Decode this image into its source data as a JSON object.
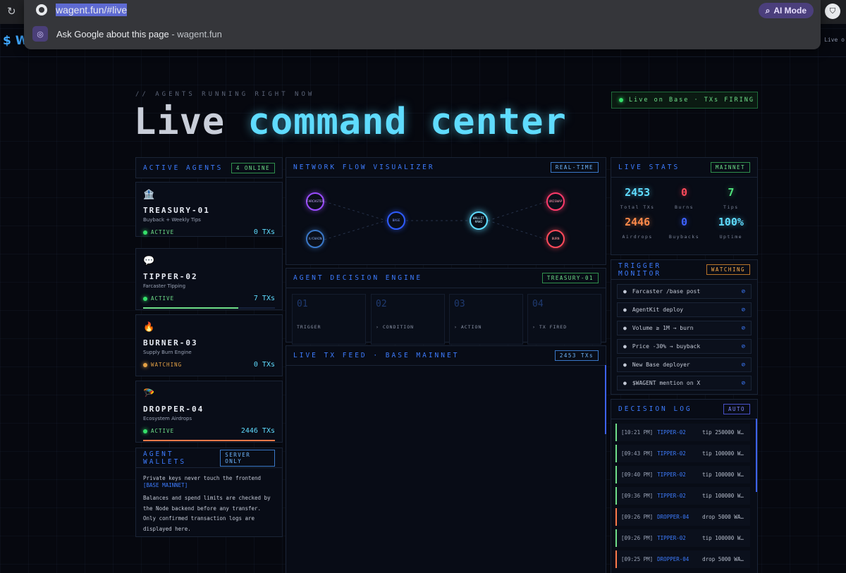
{
  "browser": {
    "url": "wagent.fun/#live",
    "ai_mode_label": "AI Mode",
    "suggestion_main": "Ask Google about this page",
    "suggestion_domain": " - wagent.fun",
    "logo_glyph": "$ W",
    "right_hint": "Live o"
  },
  "header": {
    "eyebrow": "// AGENTS RUNNING RIGHT NOW",
    "title_part1": "Live",
    "title_part2": "command center",
    "live_pill": "Live on Base · TXs FIRING"
  },
  "active_agents": {
    "title": "ACTIVE AGENTS",
    "badge": "4 ONLINE",
    "agents": [
      {
        "emoji": "🏦",
        "name": "TREASURY-01",
        "desc": "Buyback + Weekly Tips",
        "status": "ACTIVE",
        "txs": "0 TXs",
        "progress": 0,
        "bar_color": "#3dd36a"
      },
      {
        "emoji": "💬",
        "name": "TIPPER-02",
        "desc": "Farcaster Tipping",
        "status": "ACTIVE",
        "txs": "7 TXs",
        "progress": 0.72,
        "bar_color": "#6fe08a"
      },
      {
        "emoji": "🔥",
        "name": "BURNER-03",
        "desc": "Supply Burn Engine",
        "status": "WATCHING",
        "txs": "0 TXs",
        "progress": 0,
        "bar_color": "#e5a145"
      },
      {
        "emoji": "🪂",
        "name": "DROPPER-04",
        "desc": "Ecosystem Airdrops",
        "status": "ACTIVE",
        "txs": "2446 TXs",
        "progress": 1.0,
        "bar_color": "#ff7a4a"
      }
    ]
  },
  "wallets": {
    "title": "AGENT WALLETS",
    "badge": "SERVER ONLY",
    "line1": "Private keys never touch the frontend",
    "line1_accent": "[BASE MAINNET]",
    "line2": "Balances and spend limits are checked by the Node backend before any transfer. Only confirmed transaction logs are displayed here."
  },
  "network": {
    "title": "NETWORK FLOW VISUALIZER",
    "badge": "REAL-TIME",
    "nodes": {
      "farcaster": "FARCASTER",
      "x_chain": "X/CHAIN",
      "base": "BASE",
      "wallet": "WALLET #AW2",
      "uniswap": "UNISWAP",
      "burn": "BURN"
    }
  },
  "decision_engine": {
    "title": "AGENT DECISION ENGINE",
    "badge": "TREASURY-01",
    "steps": [
      {
        "num": "01",
        "label": "TRIGGER"
      },
      {
        "num": "02",
        "label": "› CONDITION"
      },
      {
        "num": "03",
        "label": "› ACTION"
      },
      {
        "num": "04",
        "label": "› TX FIRED"
      }
    ]
  },
  "tx_feed": {
    "title": "LIVE TX FEED · BASE MAINNET",
    "badge": "2453 TXs"
  },
  "stats": {
    "title": "LIVE STATS",
    "badge": "MAINNET",
    "items": [
      {
        "value": "2453",
        "label": "Total TXs",
        "color": "#5fdcff"
      },
      {
        "value": "0",
        "label": "Burns",
        "color": "#ff4a5a"
      },
      {
        "value": "7",
        "label": "Tips",
        "color": "#4ee07a"
      },
      {
        "value": "2446",
        "label": "Airdrops",
        "color": "#ff8a4a"
      },
      {
        "value": "0",
        "label": "Buybacks",
        "color": "#3d62ff"
      },
      {
        "value": "100%",
        "label": "Uptime",
        "color": "#5fdcff"
      }
    ]
  },
  "triggers": {
    "title": "TRIGGER MONITOR",
    "badge": "WATCHING",
    "items": [
      {
        "label": "Farcaster /base post",
        "mark": "⊘"
      },
      {
        "label": "AgentKit deploy",
        "mark": "⊘"
      },
      {
        "label": "Volume ≥ 1M → burn",
        "mark": "⊘"
      },
      {
        "label": "Price -30% → buyback",
        "mark": "⊘"
      },
      {
        "label": "New Base deployer",
        "mark": "⊘"
      },
      {
        "label": "$WAGENT mention on X",
        "mark": "⊘"
      }
    ]
  },
  "decision_log": {
    "title": "DECISION LOG",
    "badge": "AUTO",
    "items": [
      {
        "time": "[10:21 PM]",
        "agent": "TIPPER-02",
        "msg": "tip 250000 W…",
        "color": "#6fe08a"
      },
      {
        "time": "[09:43 PM]",
        "agent": "TIPPER-02",
        "msg": "tip 100000 W…",
        "color": "#6fe08a"
      },
      {
        "time": "[09:40 PM]",
        "agent": "TIPPER-02",
        "msg": "tip 100000 W…",
        "color": "#6fe08a"
      },
      {
        "time": "[09:36 PM]",
        "agent": "TIPPER-02",
        "msg": "tip 100000 W…",
        "color": "#6fe08a"
      },
      {
        "time": "[09:26 PM]",
        "agent": "DROPPER-04",
        "msg": "drop 5000 WA…",
        "color": "#ff7a4a"
      },
      {
        "time": "[09:26 PM]",
        "agent": "TIPPER-02",
        "msg": "tip 100000 W…",
        "color": "#6fe08a"
      },
      {
        "time": "[09:25 PM]",
        "agent": "DROPPER-04",
        "msg": "drop 5000 WA…",
        "color": "#ff7a4a"
      }
    ]
  }
}
